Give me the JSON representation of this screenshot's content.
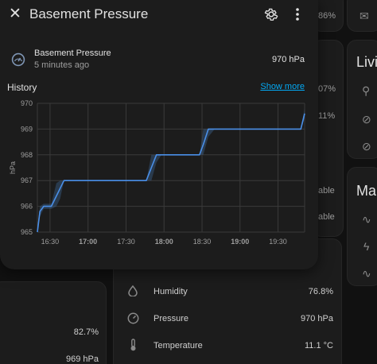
{
  "background": {
    "top_right_value": "86%",
    "card_living_title": "Livi",
    "card_living_values": [
      "07%",
      "11%",
      "able",
      "able"
    ],
    "card_ma_title": "Ma",
    "left_bottom_values": [
      "82.7%",
      "969 hPa"
    ],
    "rows": [
      {
        "icon": "water-drop-icon",
        "label": "Humidity",
        "value": "76.8%"
      },
      {
        "icon": "gauge-icon",
        "label": "Pressure",
        "value": "970 hPa"
      },
      {
        "icon": "thermometer-icon",
        "label": "Temperature",
        "value": "11.1 °C"
      }
    ]
  },
  "dialog": {
    "title": "Basement Pressure",
    "entity_name": "Basement Pressure",
    "last_changed": "5 minutes ago",
    "state": "970 hPa",
    "history_title": "History",
    "show_more": "Show more"
  },
  "colors": {
    "line": "#4a8fe8",
    "band": "#3a5f8a",
    "link": "#03a9f4"
  },
  "chart_data": {
    "type": "line",
    "title": "",
    "xlabel": "",
    "ylabel": "hPa",
    "ylim": [
      965,
      970
    ],
    "yticks": [
      "965",
      "966",
      "967",
      "968",
      "969",
      "970"
    ],
    "xticks": [
      {
        "t": 0,
        "label": "16:30",
        "bold": false
      },
      {
        "t": 30,
        "label": "17:00",
        "bold": true
      },
      {
        "t": 60,
        "label": "17:30",
        "bold": false
      },
      {
        "t": 90,
        "label": "18:00",
        "bold": true
      },
      {
        "t": 120,
        "label": "18:30",
        "bold": false
      },
      {
        "t": 150,
        "label": "19:00",
        "bold": true
      },
      {
        "t": 180,
        "label": "19:30",
        "bold": false
      }
    ],
    "xrange": [
      -10,
      201
    ],
    "grid": true,
    "series": [
      {
        "points": [
          [
            -10,
            965.0
          ],
          [
            -8,
            965.8
          ],
          [
            -5,
            966.0
          ],
          [
            1,
            966.0
          ],
          [
            5,
            966.4
          ],
          [
            8,
            966.7
          ],
          [
            11,
            967.0
          ],
          [
            16,
            967.0
          ],
          [
            76,
            967.0
          ],
          [
            80,
            967.5
          ],
          [
            84,
            968.0
          ],
          [
            88,
            968.0
          ],
          [
            118,
            968.0
          ],
          [
            121,
            968.4
          ],
          [
            125,
            969.0
          ],
          [
            130,
            969.0
          ],
          [
            198,
            969.0
          ],
          [
            201,
            969.6
          ]
        ],
        "band_upper": [
          [
            -10,
            965.2
          ],
          [
            -8,
            966.0
          ],
          [
            -5,
            966.1
          ],
          [
            1,
            966.1
          ],
          [
            5,
            966.9
          ],
          [
            8,
            967.0
          ],
          [
            11,
            967.0
          ],
          [
            76,
            967.0
          ],
          [
            80,
            968.0
          ],
          [
            84,
            968.0
          ],
          [
            118,
            968.0
          ],
          [
            121,
            969.0
          ],
          [
            125,
            969.0
          ],
          [
            198,
            969.0
          ],
          [
            201,
            969.8
          ]
        ],
        "band_lower": [
          [
            -10,
            965.0
          ],
          [
            -8,
            965.6
          ],
          [
            -5,
            965.9
          ],
          [
            1,
            965.9
          ],
          [
            5,
            966.0
          ],
          [
            8,
            966.3
          ],
          [
            11,
            967.0
          ],
          [
            76,
            967.0
          ],
          [
            80,
            967.0
          ],
          [
            84,
            967.7
          ],
          [
            88,
            968.0
          ],
          [
            118,
            968.0
          ],
          [
            121,
            968.0
          ],
          [
            125,
            968.7
          ],
          [
            130,
            969.0
          ],
          [
            198,
            969.0
          ],
          [
            201,
            969.4
          ]
        ]
      }
    ]
  }
}
